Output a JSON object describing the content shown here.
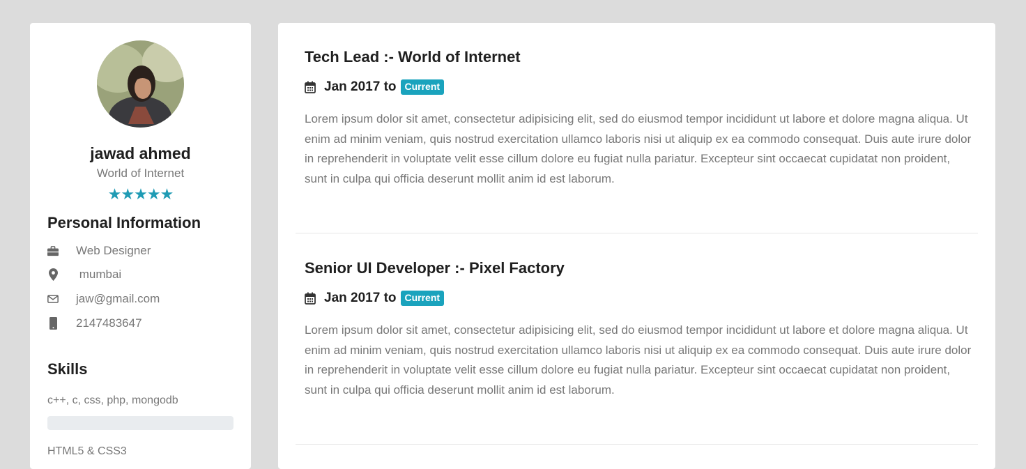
{
  "profile": {
    "name": "jawad ahmed",
    "company": "World of Internet",
    "rating": 5
  },
  "personal": {
    "heading": "Personal Information",
    "items": [
      {
        "icon": "briefcase-icon",
        "text": "Web Designer"
      },
      {
        "icon": "map-marker-icon",
        "text": " mumbai"
      },
      {
        "icon": "envelope-icon",
        "text": "jaw@gmail.com"
      },
      {
        "icon": "mobile-icon",
        "text": "2147483647"
      }
    ]
  },
  "skills": {
    "heading": "Skills",
    "items": [
      {
        "label": "c++, c, css, php, mongodb",
        "progress": 0
      },
      {
        "label": "HTML5 & CSS3"
      }
    ]
  },
  "experience": [
    {
      "title": "Tech Lead :- World of Internet",
      "date": "Jan 2017 to",
      "badge": "Current",
      "description": "Lorem ipsum dolor sit amet, consectetur adipisicing elit, sed do eiusmod tempor incididunt ut labore et dolore magna aliqua. Ut enim ad minim veniam, quis nostrud exercitation ullamco laboris nisi ut aliquip ex ea commodo consequat. Duis aute irure dolor in reprehenderit in voluptate velit esse cillum dolore eu fugiat nulla pariatur. Excepteur sint occaecat cupidatat non proident, sunt in culpa qui officia deserunt mollit anim id est laborum."
    },
    {
      "title": "Senior UI Developer :- Pixel Factory",
      "date": "Jan 2017 to",
      "badge": "Current",
      "description": "Lorem ipsum dolor sit amet, consectetur adipisicing elit, sed do eiusmod tempor incididunt ut labore et dolore magna aliqua. Ut enim ad minim veniam, quis nostrud exercitation ullamco laboris nisi ut aliquip ex ea commodo consequat. Duis aute irure dolor in reprehenderit in voluptate velit esse cillum dolore eu fugiat nulla pariatur. Excepteur sint occaecat cupidatat non proident, sunt in culpa qui officia deserunt mollit anim id est laborum."
    }
  ],
  "colors": {
    "accent": "#1f9bb4",
    "badge": "#1aa3bd",
    "background": "#dcdcdc"
  }
}
